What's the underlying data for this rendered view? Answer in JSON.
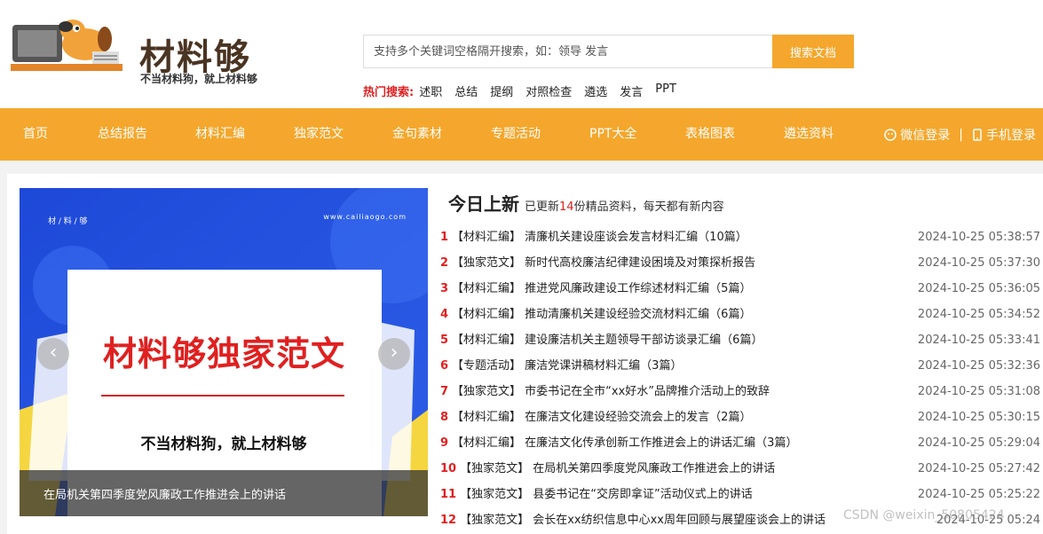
{
  "logo": {
    "title": "材料够",
    "slogan": "不当材料狗，就上材料够"
  },
  "search": {
    "placeholder": "支持多个关键词空格隔开搜索，如：领导 发言",
    "button_label": "搜索文档"
  },
  "hot": {
    "label": "热门搜索:",
    "items": [
      "述职",
      "总结",
      "提纲",
      "对照检查",
      "遴选",
      "发言",
      "PPT"
    ]
  },
  "nav": {
    "items": [
      "首页",
      "总结报告",
      "材料汇编",
      "独家范文",
      "金句素材",
      "专题活动",
      "PPT大全",
      "表格图表",
      "遴选资料"
    ],
    "wechat_login": "微信登录",
    "separator": "|",
    "phone_login": "手机登录"
  },
  "banner": {
    "brand_small": "材 / 料 / 够",
    "site_url": "www.cailiaogo.com",
    "headline": "材料够独家范文",
    "sub_headline": "不当材料狗，就上材料够",
    "caption": "在局机关第四季度党风廉政工作推进会上的讲话",
    "prev_arrow": "‹",
    "next_arrow": "›"
  },
  "news": {
    "title": "今日上新",
    "sub_prefix": "已更新",
    "count": "14",
    "sub_suffix": "份精品资料，每天都有新内容",
    "rows": [
      {
        "num": "1",
        "text": "【材料汇编】 清廉机关建设座谈会发言材料汇编（10篇）",
        "date": "2024-10-25 05:38:57"
      },
      {
        "num": "2",
        "text": "【独家范文】 新时代高校廉洁纪律建设困境及对策探析报告",
        "date": "2024-10-25 05:37:30"
      },
      {
        "num": "3",
        "text": "【材料汇编】 推进党风廉政建设工作综述材料汇编（5篇）",
        "date": "2024-10-25 05:36:05"
      },
      {
        "num": "4",
        "text": "【材料汇编】 推动清廉机关建设经验交流材料汇编（6篇）",
        "date": "2024-10-25 05:34:52"
      },
      {
        "num": "5",
        "text": "【材料汇编】 建设廉洁机关主题领导干部访谈录汇编（6篇）",
        "date": "2024-10-25 05:33:41"
      },
      {
        "num": "6",
        "text": "【专题活动】 廉洁党课讲稿材料汇编（3篇）",
        "date": "2024-10-25 05:32:36"
      },
      {
        "num": "7",
        "text": "【独家范文】 市委书记在全市“xx好水”品牌推介活动上的致辞",
        "date": "2024-10-25 05:31:08"
      },
      {
        "num": "8",
        "text": "【材料汇编】 在廉洁文化建设经验交流会上的发言（2篇）",
        "date": "2024-10-25 05:30:15"
      },
      {
        "num": "9",
        "text": "【材料汇编】 在廉洁文化传承创新工作推进会上的讲话汇编（3篇）",
        "date": "2024-10-25 05:29:04"
      },
      {
        "num": "10",
        "text": "【独家范文】 在局机关第四季度党风廉政工作推进会上的讲话",
        "date": "2024-10-25 05:27:42"
      },
      {
        "num": "11",
        "text": "【独家范文】 县委书记在“交房即拿证”活动仪式上的讲话",
        "date": "2024-10-25 05:25:22"
      },
      {
        "num": "12",
        "text": "【独家范文】 会长在xx纺织信息中心xx周年回顾与展望座谈会上的讲话",
        "date": "2024-10-25 05:24"
      }
    ]
  },
  "watermark": "CSDN @weixin_50805424"
}
